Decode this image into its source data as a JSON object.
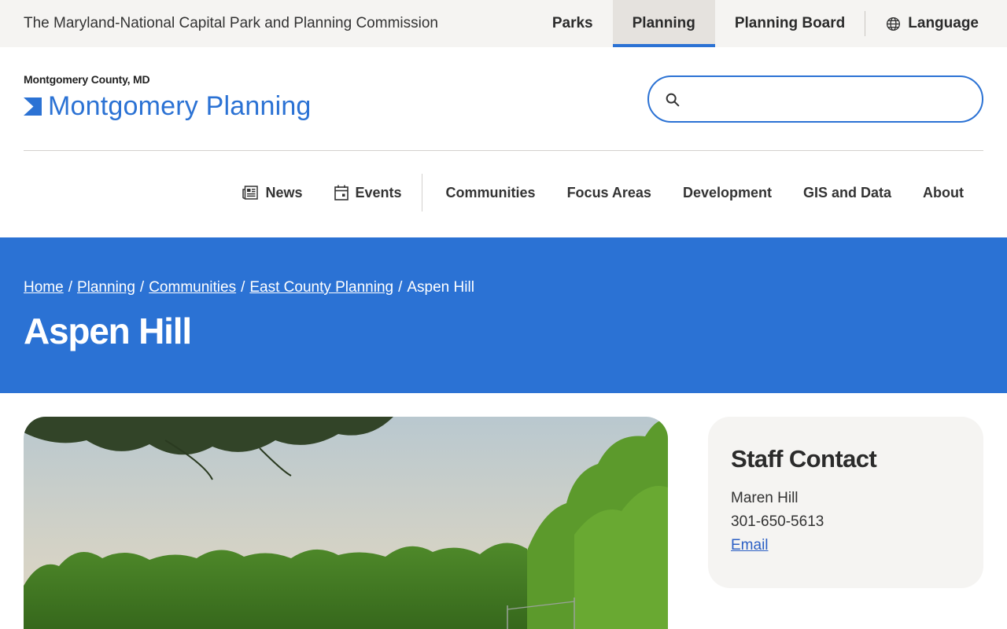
{
  "topbar": {
    "org_name": "The Maryland-National Capital Park and Planning Commission",
    "nav": [
      {
        "label": "Parks"
      },
      {
        "label": "Planning",
        "active": true
      },
      {
        "label": "Planning Board"
      }
    ],
    "language_label": "Language",
    "language_icon": "globe-icon"
  },
  "header": {
    "brand_sub": "Montgomery County, MD",
    "brand_name": "Montgomery Planning",
    "search": {
      "value": "",
      "placeholder": "",
      "icon": "search-icon"
    }
  },
  "mainnav": {
    "news": {
      "label": "News",
      "icon": "newspaper-icon"
    },
    "events": {
      "label": "Events",
      "icon": "calendar-icon"
    },
    "items": [
      {
        "label": "Communities"
      },
      {
        "label": "Focus Areas"
      },
      {
        "label": "Development"
      },
      {
        "label": "GIS and Data"
      },
      {
        "label": "About"
      }
    ]
  },
  "hero": {
    "breadcrumb": [
      "Home",
      "Planning",
      "Communities",
      "East County Planning",
      "Aspen Hill"
    ],
    "title": "Aspen Hill"
  },
  "contact": {
    "heading": "Staff Contact",
    "name": "Maren Hill",
    "phone": "301-650-5613",
    "email_label": "Email"
  },
  "colors": {
    "brand_blue": "#2b72d4",
    "topbar_bg": "#f5f4f2",
    "card_bg": "#f5f4f2"
  }
}
